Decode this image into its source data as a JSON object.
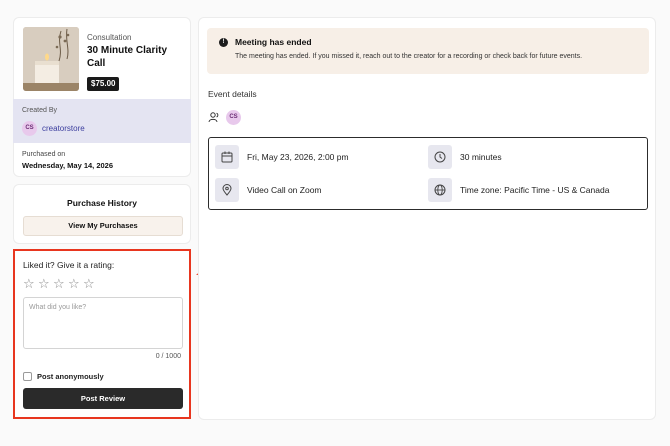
{
  "product": {
    "kind": "Consultation",
    "title": "30 Minute Clarity Call",
    "price": "$75.00",
    "created_by_label": "Created By",
    "creator_initials": "CS",
    "creator_name": "creatorstore",
    "purchased_label": "Purchased on",
    "purchased_date": "Wednesday, May 14, 2026"
  },
  "history": {
    "title": "Purchase History",
    "button_label": "View My Purchases"
  },
  "rating": {
    "prompt": "Liked it? Give it a rating:",
    "star_count": 5,
    "placeholder": "What did you like?",
    "char_count": "0 / 1000",
    "anonymous_label": "Post anonymously",
    "submit_label": "Post Review"
  },
  "alert": {
    "title": "Meeting has ended",
    "message": "The meeting has ended. If you missed it, reach out to the creator for a recording or check back for future events."
  },
  "event": {
    "section_label": "Event details",
    "host_initials": "CS",
    "date_time": "Fri, May 23, 2026, 2:00 pm",
    "duration": "30 minutes",
    "location": "Video Call on Zoom",
    "timezone": "Time zone: Pacific Time - US & Canada"
  },
  "colors": {
    "highlight": "#e8361f",
    "creator_bg": "#e4e4f2",
    "alert_bg": "#f7efe7",
    "primary_button": "#2a2a2a",
    "link": "#3b3d9e"
  }
}
